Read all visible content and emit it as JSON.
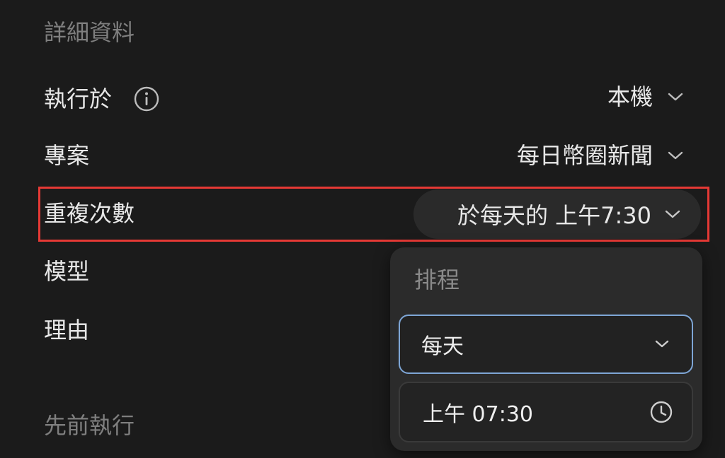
{
  "details": {
    "section_title": "詳細資料",
    "rows": {
      "run_on": {
        "label": "執行於",
        "value": "本機"
      },
      "project": {
        "label": "專案",
        "value": "每日幣圈新聞"
      },
      "repeat": {
        "label": "重複次數",
        "value": "於每天的 上午7:30"
      },
      "model": {
        "label": "模型"
      },
      "reason": {
        "label": "理由"
      }
    }
  },
  "previous_runs": {
    "section_title": "先前執行"
  },
  "schedule_popover": {
    "title": "排程",
    "frequency": "每天",
    "time": "上午 07:30"
  },
  "icons": {
    "info": "info-icon",
    "chevron": "chevron-down-icon",
    "clock": "clock-icon"
  },
  "colors": {
    "background": "#1b1b1b",
    "highlight": "#e53935",
    "focus_border": "#7ea6d6"
  }
}
